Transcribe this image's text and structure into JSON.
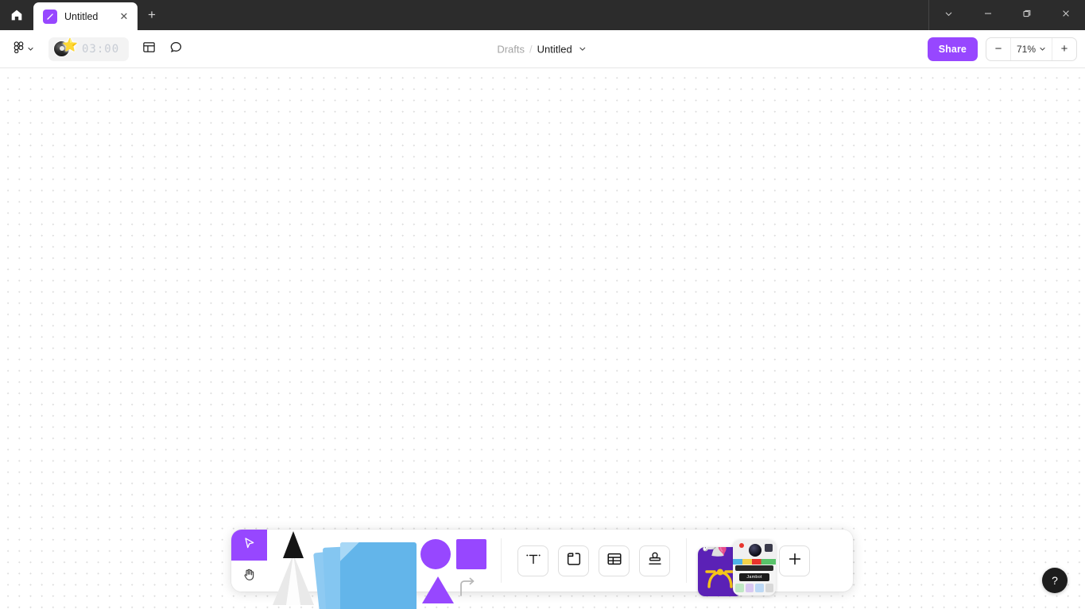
{
  "window": {
    "home_tooltip": "Home",
    "tab": {
      "title": "Untitled",
      "close_label": "✕",
      "icon": "figjam-icon"
    },
    "new_tab_label": "+",
    "controls": {
      "chevron_label": "chevron-down",
      "minimize_label": "minimize",
      "maximize_label": "maximize",
      "close_label": "close"
    }
  },
  "toolbar": {
    "figma_menu_label": "figma-logo",
    "timer": {
      "value": "03:00",
      "avatar_emoji": "⭐"
    },
    "layout_label": "layout-panel",
    "comment_label": "comment",
    "breadcrumb": {
      "parent": "Drafts",
      "separator": "/",
      "name": "Untitled"
    },
    "share_label": "Share",
    "zoom": {
      "minus": "−",
      "value": "71%",
      "plus": "+"
    }
  },
  "bottom_toolbar": {
    "select_tool": "move-cursor",
    "hand_tool": "hand",
    "marker_tool": "marker-pen",
    "sticky_tool": "sticky-note",
    "shapes_tool": "shapes-and-connectors",
    "inserts": [
      {
        "name": "text-tool",
        "label": "T"
      },
      {
        "name": "section-tool",
        "label": "section"
      },
      {
        "name": "table-tool",
        "label": "table"
      },
      {
        "name": "stamp-tool",
        "label": "stamp"
      }
    ],
    "widgets": {
      "jambot_label": "Jambot",
      "more_label": "+"
    }
  },
  "canvas": {
    "help_label": "?"
  },
  "colors": {
    "accent": "#9747ff",
    "titlebar": "#2c2c2c",
    "canvas_bg": "#ffffff",
    "dot_grid": "#dcdcdc",
    "sticky_blue": "#63b5ea"
  }
}
